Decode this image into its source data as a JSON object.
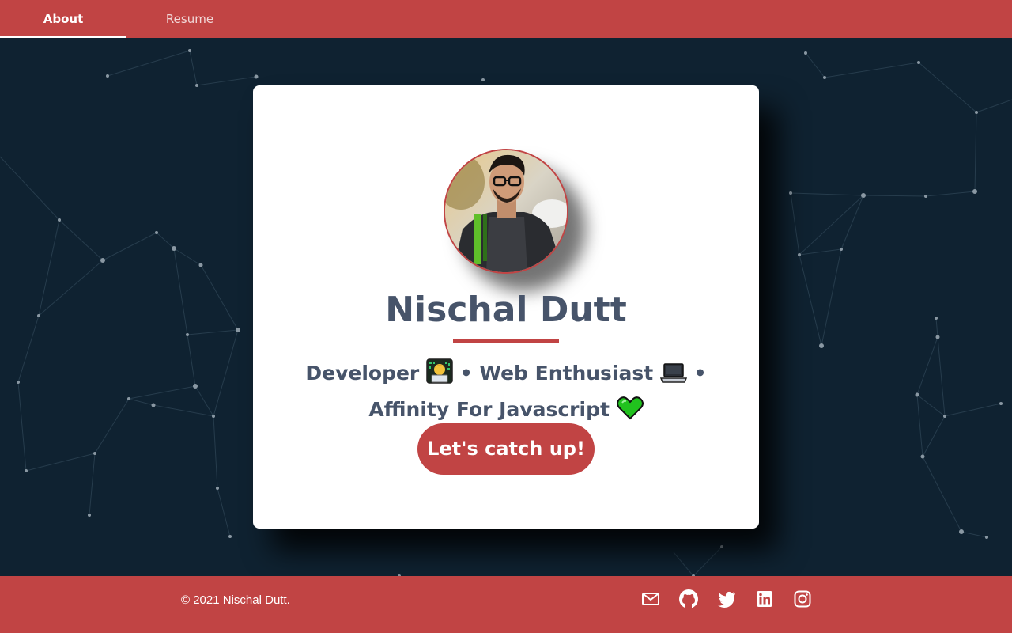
{
  "nav": {
    "tabs": [
      {
        "label": "About",
        "active": true
      },
      {
        "label": "Resume",
        "active": false
      }
    ]
  },
  "profile": {
    "name": "Nischal Dutt",
    "tagline": {
      "developer": "Developer",
      "bullet1": "•",
      "web": "Web Enthusiast",
      "bullet2": "•",
      "affinity": "Affinity For Javascript"
    },
    "emojis": [
      "technologist-icon",
      "laptop-icon",
      "green-heart-icon"
    ],
    "cta_label": "Let's catch up!"
  },
  "footer": {
    "copyright": "© 2021 Nischal Dutt.",
    "social_icons": [
      "mail-icon",
      "github-icon",
      "twitter-icon",
      "linkedin-icon",
      "instagram-icon"
    ]
  },
  "colors": {
    "accent": "#c14444",
    "background": "#0f2231",
    "text": "#47546a",
    "card": "#ffffff"
  }
}
